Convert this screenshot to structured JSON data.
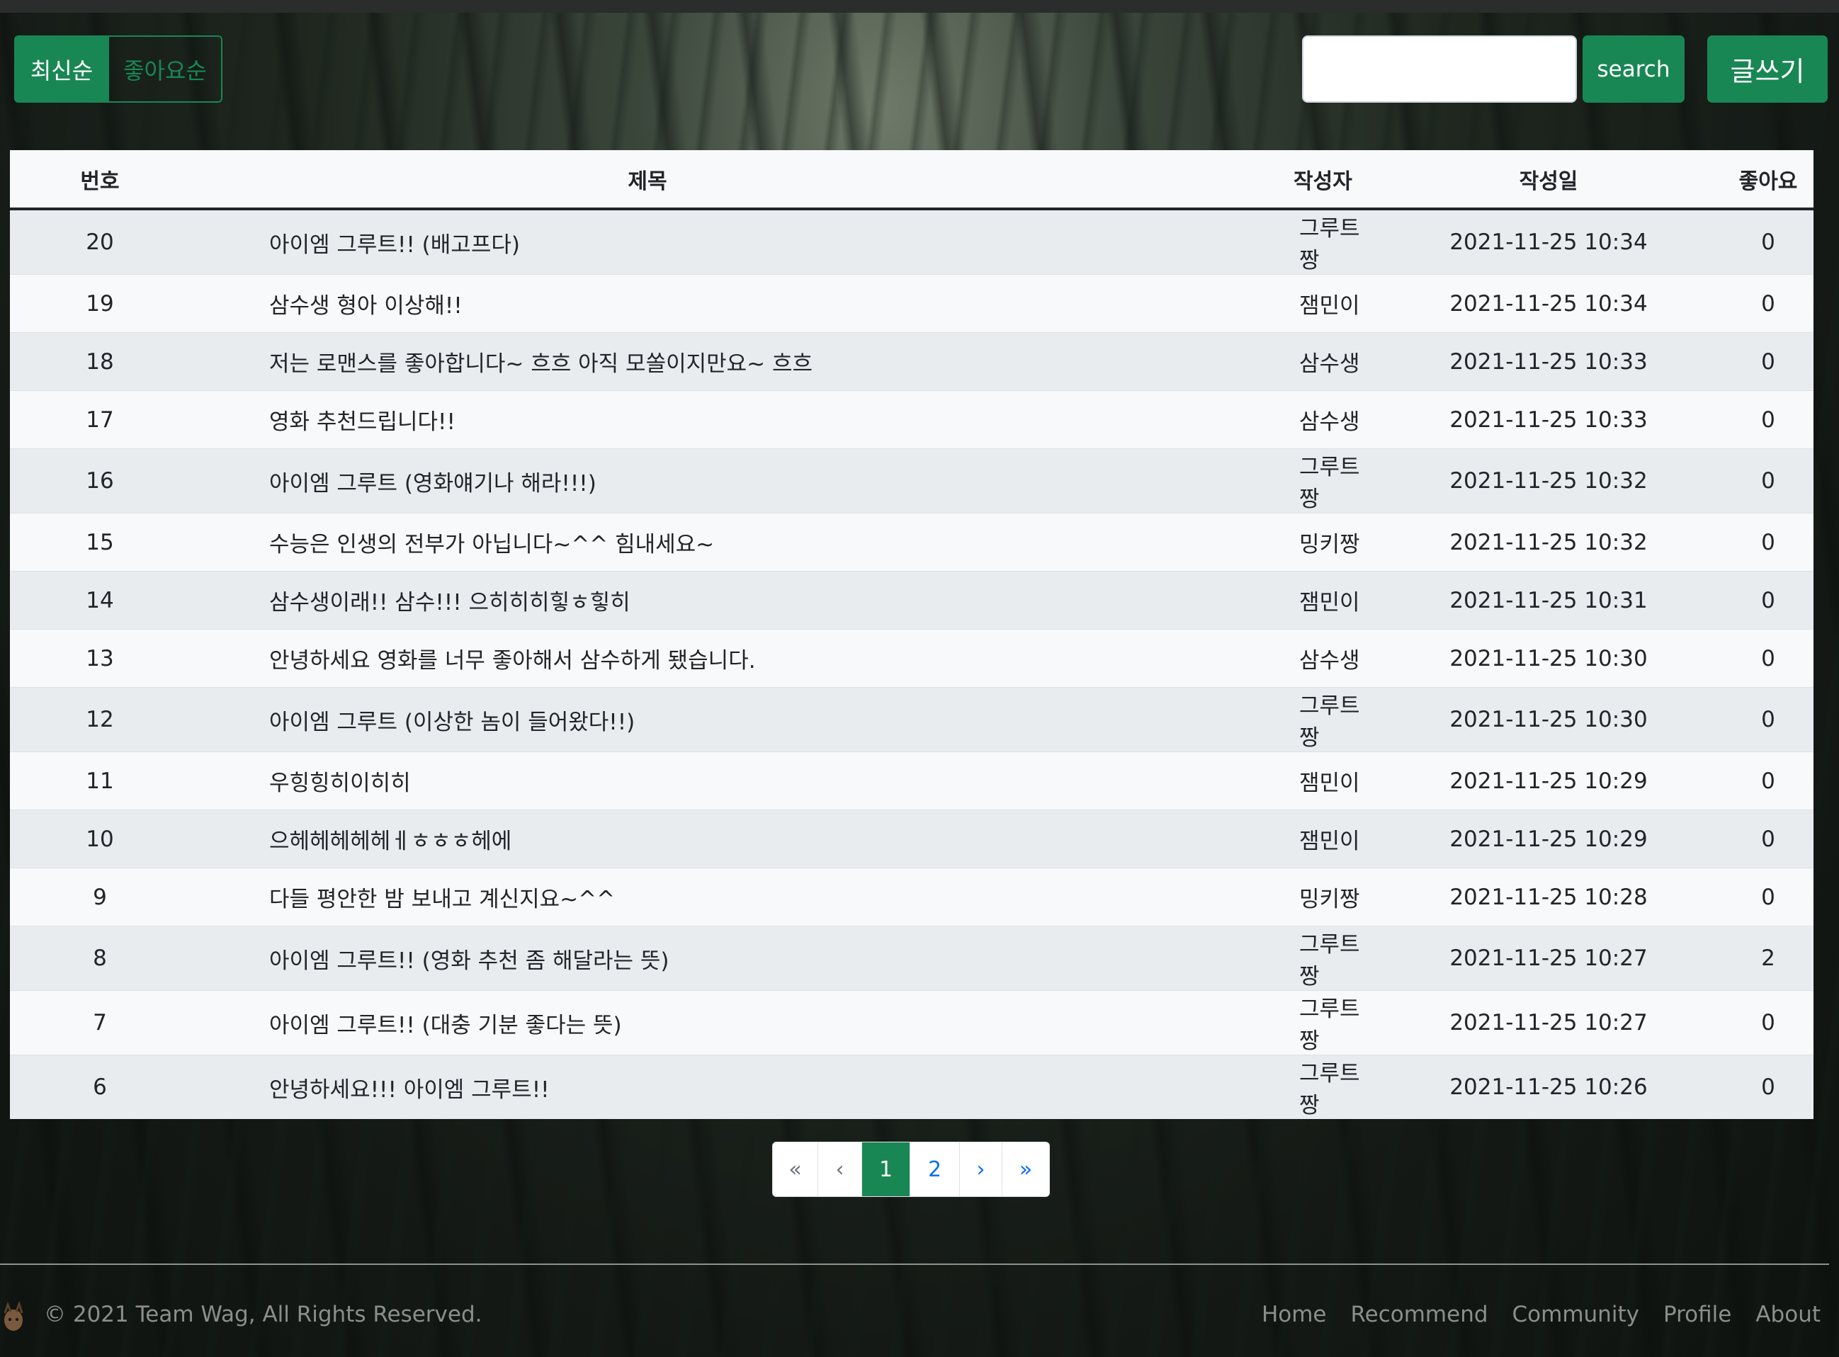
{
  "sort": {
    "latest_label": "최신순",
    "likes_label": "좋아요순"
  },
  "search": {
    "value": "",
    "button_label": "search"
  },
  "write_label": "글쓰기",
  "table": {
    "headers": {
      "num": "번호",
      "title": "제목",
      "author": "작성자",
      "date": "작성일",
      "likes": "좋아요"
    },
    "rows": [
      {
        "num": "20",
        "title": "아이엠 그루트!! (배고프다)",
        "author": "그루트짱",
        "date": "2021-11-25 10:34",
        "likes": "0"
      },
      {
        "num": "19",
        "title": "삼수생 형아 이상해!!",
        "author": "잼민이",
        "date": "2021-11-25 10:34",
        "likes": "0"
      },
      {
        "num": "18",
        "title": "저는 로맨스를 좋아합니다~ 흐흐 아직 모쏠이지만요~ 흐흐",
        "author": "삼수생",
        "date": "2021-11-25 10:33",
        "likes": "0"
      },
      {
        "num": "17",
        "title": "영화 추천드립니다!!",
        "author": "삼수생",
        "date": "2021-11-25 10:33",
        "likes": "0"
      },
      {
        "num": "16",
        "title": "아이엠 그루트 (영화얘기나 해라!!!)",
        "author": "그루트짱",
        "date": "2021-11-25 10:32",
        "likes": "0"
      },
      {
        "num": "15",
        "title": "수능은 인생의 전부가 아닙니다~^^ 힘내세요~",
        "author": "밍키짱",
        "date": "2021-11-25 10:32",
        "likes": "0"
      },
      {
        "num": "14",
        "title": "삼수생이래!! 삼수!!! 으히히히힣ㅎ힣히",
        "author": "잼민이",
        "date": "2021-11-25 10:31",
        "likes": "0"
      },
      {
        "num": "13",
        "title": "안녕하세요 영화를 너무 좋아해서 삼수하게 됐습니다.",
        "author": "삼수생",
        "date": "2021-11-25 10:30",
        "likes": "0"
      },
      {
        "num": "12",
        "title": "아이엠 그루트 (이상한 놈이 들어왔다!!)",
        "author": "그루트짱",
        "date": "2021-11-25 10:30",
        "likes": "0"
      },
      {
        "num": "11",
        "title": "우힝힝히이히히",
        "author": "잼민이",
        "date": "2021-11-25 10:29",
        "likes": "0"
      },
      {
        "num": "10",
        "title": "으헤헤헤헤헤ㅔㅎㅎㅎ헤에",
        "author": "잼민이",
        "date": "2021-11-25 10:29",
        "likes": "0"
      },
      {
        "num": "9",
        "title": "다들 평안한 밤 보내고 계신지요~^^",
        "author": "밍키짱",
        "date": "2021-11-25 10:28",
        "likes": "0"
      },
      {
        "num": "8",
        "title": "아이엠 그루트!! (영화 추천 좀 해달라는 뜻)",
        "author": "그루트짱",
        "date": "2021-11-25 10:27",
        "likes": "2"
      },
      {
        "num": "7",
        "title": "아이엠 그루트!! (대충 기분 좋다는 뜻)",
        "author": "그루트짱",
        "date": "2021-11-25 10:27",
        "likes": "0"
      },
      {
        "num": "6",
        "title": "안녕하세요!!! 아이엠 그루트!!",
        "author": "그루트짱",
        "date": "2021-11-25 10:26",
        "likes": "0"
      }
    ]
  },
  "pagination": {
    "first": "«",
    "prev": "‹",
    "pages": [
      "1",
      "2"
    ],
    "active": "1",
    "next": "›",
    "last": "»"
  },
  "footer": {
    "copyright": "© 2021 Team Wag, All Rights Reserved.",
    "nav": [
      "Home",
      "Recommend",
      "Community",
      "Profile",
      "About"
    ]
  },
  "colors": {
    "accent": "#198754",
    "link": "#0d6efd"
  }
}
